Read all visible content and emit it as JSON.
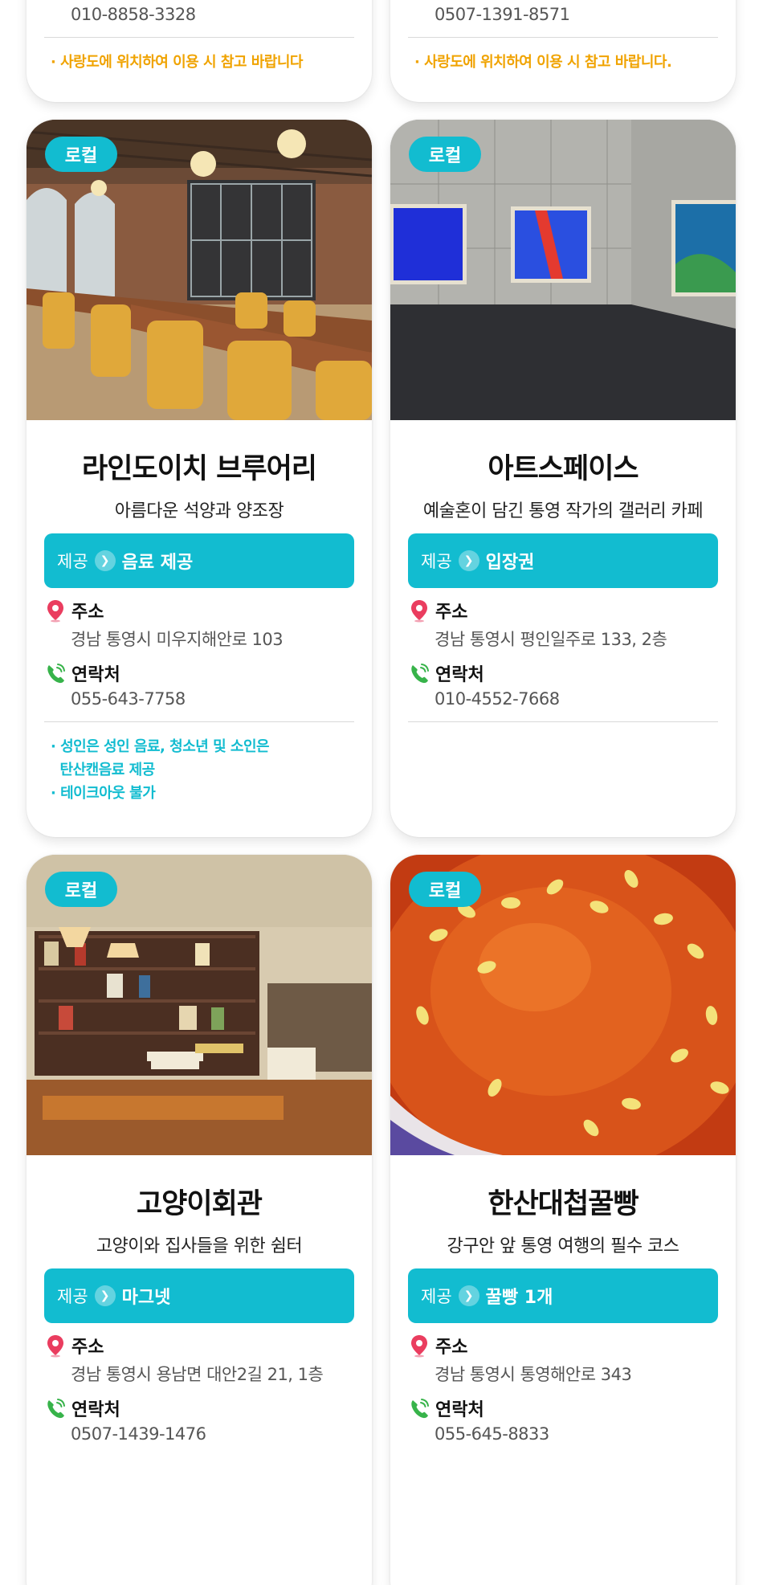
{
  "labels": {
    "badge": "로컬",
    "offer_prefix": "제공",
    "address": "주소",
    "contact": "연락처"
  },
  "colors": {
    "accent": "#12bcd0",
    "note_orange": "#f0a300",
    "pin": "#ea3d5f",
    "phone": "#37b34a"
  },
  "top_cards": [
    {
      "phone": "010-8858-3328",
      "note": "· 사랑도에 위치하여 이용 시 참고 바랍니다"
    },
    {
      "phone": "0507-1391-8571",
      "note": "· 사랑도에 위치하여 이용 시 참고 바랍니다."
    }
  ],
  "cards": [
    {
      "name": "라인도이치 브루어리",
      "tagline": "아름다운 석양과 양조장",
      "offer": "음료 제공",
      "address": "경남 통영시 미우지해안로 103",
      "phone": "055-643-7758",
      "notes": [
        "· 성인은 성인 음료, 청소년 및 소인은",
        "  탄산캔음료 제공",
        "· 테이크아웃 불가"
      ],
      "image": "brewery-interior-photo"
    },
    {
      "name": "아트스페이스",
      "tagline": "예술혼이 담긴 통영 작가의 갤러리 카페",
      "offer": "입장권",
      "address": "경남 통영시 평인일주로 133, 2층",
      "phone": "010-4552-7668",
      "notes": [],
      "image": "gallery-interior-photo"
    },
    {
      "name": "고양이회관",
      "tagline": "고양이와 집사들을 위한 쉼터",
      "offer": "마그넷",
      "address": "경남 통영시 용남면 대안2길 21, 1층",
      "phone": "0507-1439-1476",
      "notes": [],
      "image": "bookshelf-cafe-photo"
    },
    {
      "name": "한산대첩꿀빵",
      "tagline": "강구안 앞 통영 여행의 필수 코스",
      "offer": "꿀빵 1개",
      "address": "경남 통영시 통영해안로 343",
      "phone": "055-645-8833",
      "notes": [],
      "image": "honey-bread-photo"
    }
  ]
}
